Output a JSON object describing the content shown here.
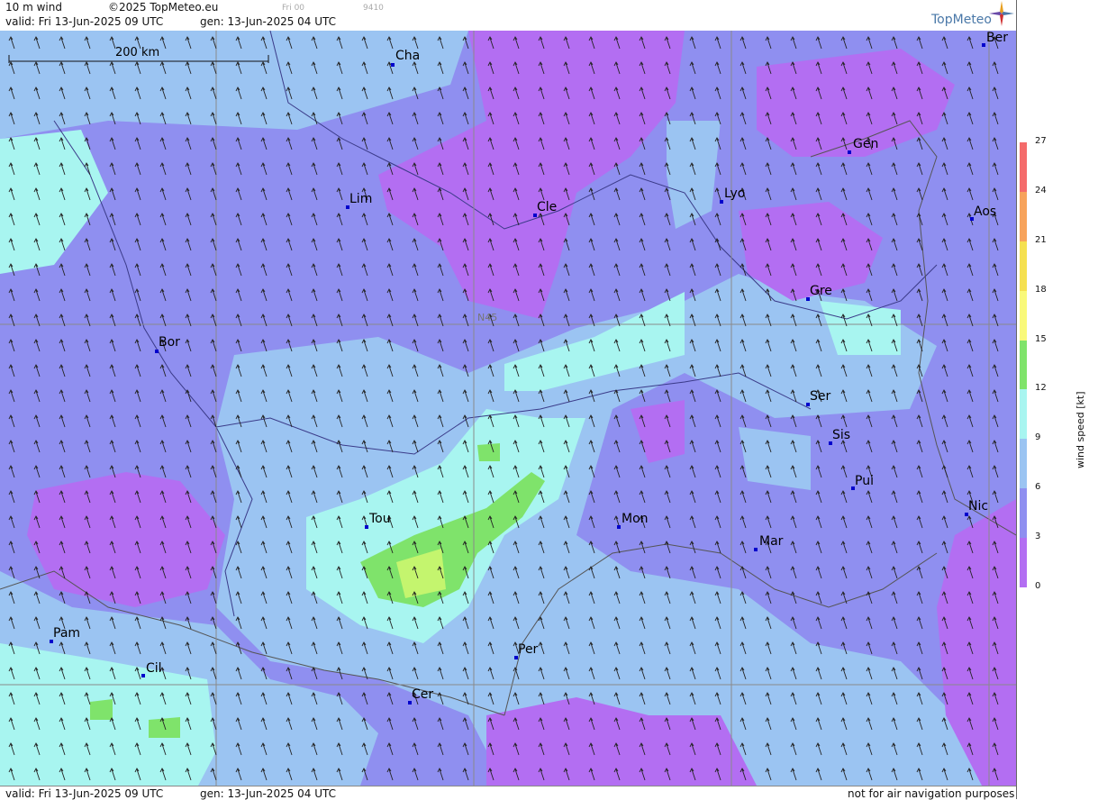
{
  "header": {
    "product": "10 m wind",
    "copyright": "©2025 TopMeteo.eu",
    "run_tag": "Fri 00",
    "code": "9410",
    "valid": "valid:  Fri  13-Jun-2025  09 UTC",
    "gen": "gen: 13-Jun-2025 04 UTC"
  },
  "logo": {
    "text": "TopMeteo"
  },
  "footer": {
    "valid": "valid:  Fri  13-Jun-2025  09 UTC",
    "gen": "gen: 13-Jun-2025 04 UTC",
    "notice": "not for air navigation purposes"
  },
  "map": {
    "scale_label": "200 km",
    "lat_label": "N45",
    "cities": [
      "Cha",
      "Ber",
      "Gen",
      "Lim",
      "Cle",
      "Lyo",
      "Aos",
      "Gre",
      "Bor",
      "Ser",
      "Sis",
      "Pui",
      "Nic",
      "Tou",
      "Mon",
      "Mar",
      "Pam",
      "Cil",
      "Per",
      "Cer"
    ]
  },
  "legend": {
    "title": "wind  speed  [kt]",
    "ticks": [
      "27",
      "24",
      "21",
      "18",
      "15",
      "12",
      "9",
      "6",
      "3",
      "0"
    ],
    "colors": [
      "#f46b6b",
      "#f7a35c",
      "#f5e050",
      "#f9f97a",
      "#7fe36b",
      "#a8f5f0",
      "#9bc4f2",
      "#8f8ff0",
      "#b36ef2",
      "#c78cf5"
    ]
  }
}
